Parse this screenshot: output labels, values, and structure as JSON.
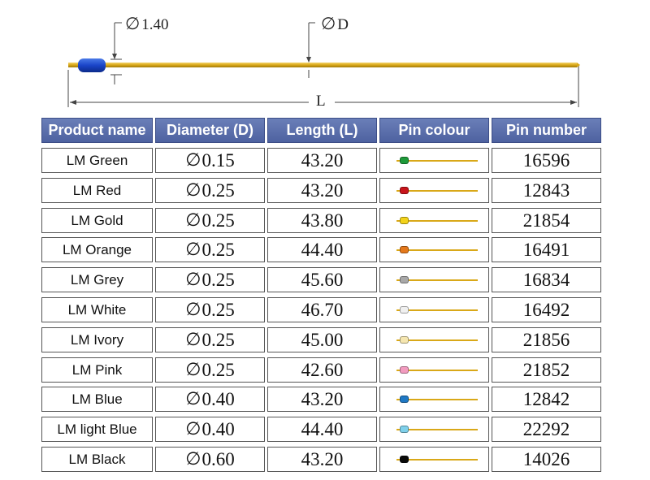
{
  "diagram": {
    "head_diameter_label": "1.40",
    "shaft_diameter_label": "D",
    "length_label": "L"
  },
  "table": {
    "headers": {
      "product_name": "Product name",
      "diameter": "Diameter (D)",
      "length": "Length (L)",
      "pin_colour": "Pin colour",
      "pin_number": "Pin number"
    },
    "rows": [
      {
        "name": "LM Green",
        "diameter": "0.15",
        "length": "43.20",
        "color": "#1e9a3a",
        "pin_number": "16596"
      },
      {
        "name": "LM Red",
        "diameter": "0.25",
        "length": "43.20",
        "color": "#c8151b",
        "pin_number": "12843"
      },
      {
        "name": "LM Gold",
        "diameter": "0.25",
        "length": "43.80",
        "color": "#f2d21a",
        "pin_number": "21854"
      },
      {
        "name": "LM Orange",
        "diameter": "0.25",
        "length": "44.40",
        "color": "#e4781c",
        "pin_number": "16491"
      },
      {
        "name": "LM Grey",
        "diameter": "0.25",
        "length": "45.60",
        "color": "#a8a8a8",
        "pin_number": "16834"
      },
      {
        "name": "LM White",
        "diameter": "0.25",
        "length": "46.70",
        "color": "#f0f0f0",
        "pin_number": "16492"
      },
      {
        "name": "LM Ivory",
        "diameter": "0.25",
        "length": "45.00",
        "color": "#f5e6b0",
        "pin_number": "21856"
      },
      {
        "name": "LM Pink",
        "diameter": "0.25",
        "length": "42.60",
        "color": "#f29bbf",
        "pin_number": "21852"
      },
      {
        "name": "LM Blue",
        "diameter": "0.40",
        "length": "43.20",
        "color": "#1f78c4",
        "pin_number": "12842"
      },
      {
        "name": "LM light Blue",
        "diameter": "0.40",
        "length": "44.40",
        "color": "#7fd0ea",
        "pin_number": "22292"
      },
      {
        "name": "LM Black",
        "diameter": "0.60",
        "length": "43.20",
        "color": "#0a0a0a",
        "pin_number": "14026"
      }
    ]
  }
}
